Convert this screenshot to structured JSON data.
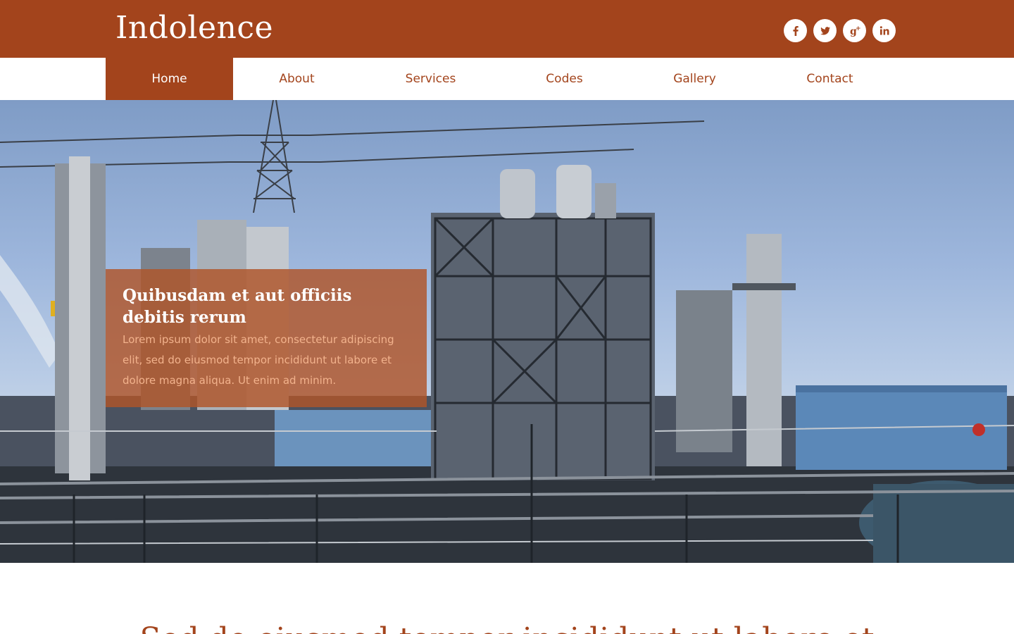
{
  "site": {
    "logo": "Indolence"
  },
  "social": [
    {
      "name": "facebook-icon",
      "glyph": "f"
    },
    {
      "name": "twitter-icon",
      "glyph": "t"
    },
    {
      "name": "google-plus-icon",
      "glyph": "g+"
    },
    {
      "name": "linkedin-icon",
      "glyph": "in"
    }
  ],
  "nav": {
    "items": [
      {
        "label": "Home",
        "active": true
      },
      {
        "label": "About"
      },
      {
        "label": "Services"
      },
      {
        "label": "Codes"
      },
      {
        "label": "Gallery"
      },
      {
        "label": "Contact"
      }
    ]
  },
  "hero": {
    "caption": {
      "title": "Quibusdam et aut officiis debitis rerum",
      "text": "Lorem ipsum dolor sit amet, consectetur adipiscing elit, sed do eiusmod tempor incididunt ut labore et dolore magna aliqua. Ut enim ad minim."
    }
  },
  "section": {
    "title": "Sed do eiusmod tempor incididunt ut labore et"
  },
  "colors": {
    "brand": "#a3441c",
    "caption_bg": "#b05428",
    "caption_text": "#f2b28c"
  }
}
